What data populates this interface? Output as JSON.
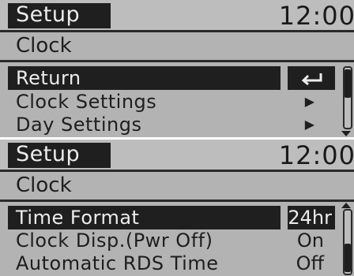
{
  "panels": [
    {
      "title": "Setup",
      "clock": "12:00",
      "subtitle": "Clock",
      "items": [
        {
          "label": "Return",
          "value_icon": "return-arrow-icon",
          "value_glyph": "⮌"
        },
        {
          "label": "Clock Settings",
          "value_icon": "chevron-right-icon",
          "value_glyph": "▶"
        },
        {
          "label": "Day Settings",
          "value_icon": "chevron-right-icon",
          "value_glyph": "▶"
        }
      ]
    },
    {
      "title": "Setup",
      "clock": "12:00",
      "subtitle": "Clock",
      "items": [
        {
          "label": "Time Format",
          "value": "24hr"
        },
        {
          "label": "Clock Disp.(Pwr Off)",
          "value": "On"
        },
        {
          "label": "Automatic RDS Time",
          "value": "Off"
        }
      ]
    }
  ],
  "colors": {
    "background": "#b3b3b3",
    "highlight": "#1f1f1f",
    "text": "#1e1e1e",
    "highlight_text": "#ececec"
  }
}
